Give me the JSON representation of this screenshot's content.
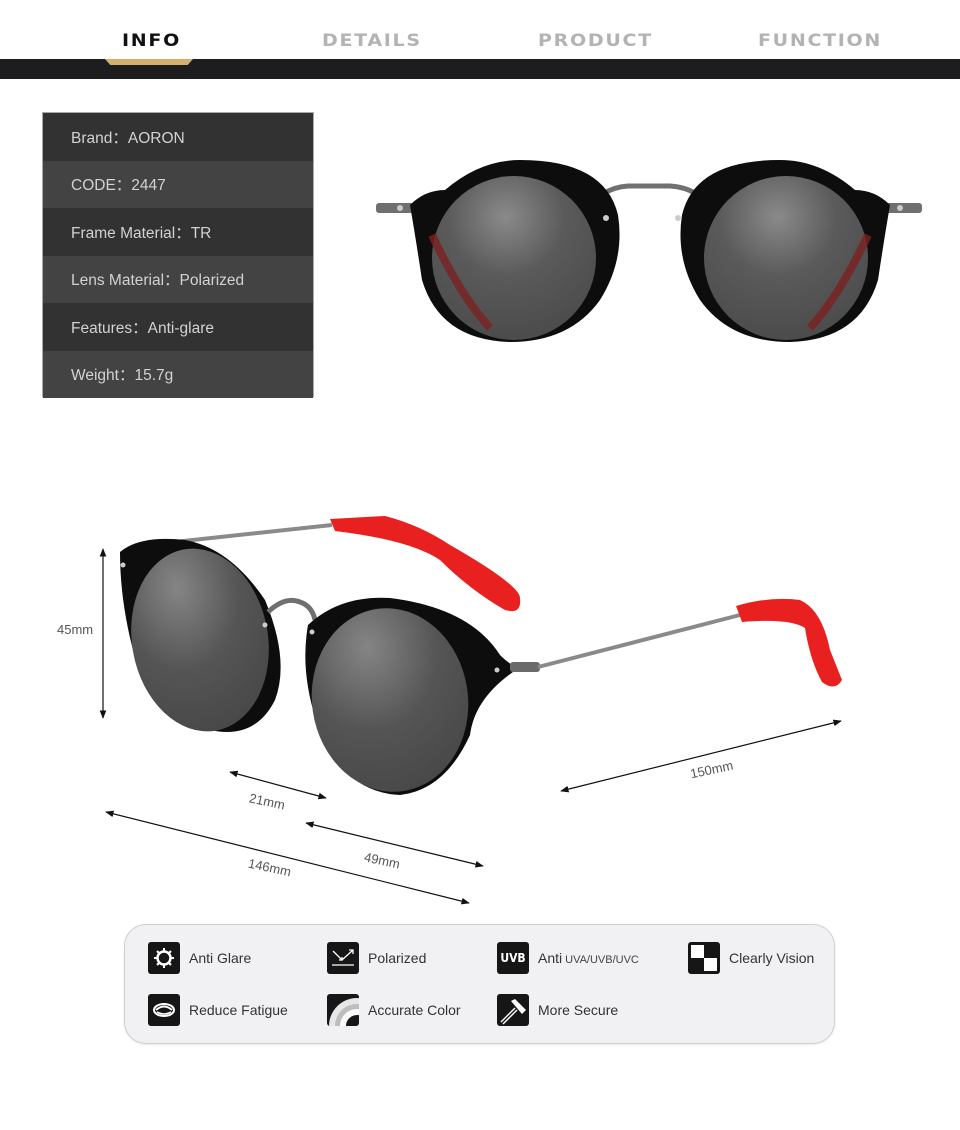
{
  "nav": {
    "tabs": [
      {
        "label": "INFO",
        "active": true
      },
      {
        "label": "DETAILS",
        "active": false
      },
      {
        "label": "PRODUCT",
        "active": false
      },
      {
        "label": "FUNCTION",
        "active": false
      }
    ],
    "colors": {
      "bar": "#1d1d1f",
      "indicator": "#d4b06d",
      "active_text": "#111111",
      "inactive_text": "#b3b3b3"
    }
  },
  "specs": [
    {
      "label": "Brand：AORON"
    },
    {
      "label": "CODE：2447"
    },
    {
      "label": "Frame Material：TR"
    },
    {
      "label": "Lens Material：Polarized"
    },
    {
      "label": "Features：Anti-glare"
    },
    {
      "label": "Weight：15.7g"
    }
  ],
  "dimensions": {
    "lens_height": "45mm",
    "bridge_width": "21mm",
    "lens_width": "49mm",
    "total_width": "146mm",
    "temple_length": "150mm"
  },
  "features": [
    {
      "icon": "sun-gear-icon",
      "label": "Anti Glare"
    },
    {
      "icon": "polarized-reflection-icon",
      "label": "Polarized"
    },
    {
      "icon": "uvb-icon",
      "icon_text": "UVB",
      "label": "Anti",
      "small": "UVA/UVB/UVC"
    },
    {
      "icon": "checker-icon",
      "label": "Clearly Vision"
    },
    {
      "icon": "eye-rings-icon",
      "label": "Reduce Fatigue"
    },
    {
      "icon": "color-arc-icon",
      "label": "Accurate Color"
    },
    {
      "icon": "hammer-icon",
      "label": "More Secure"
    }
  ]
}
